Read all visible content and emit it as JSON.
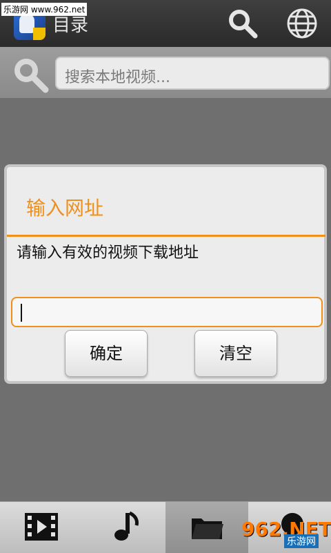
{
  "watermark": "乐游网 www.962.net",
  "header": {
    "title": "目录"
  },
  "search": {
    "placeholder": "搜索本地视频..."
  },
  "dialog": {
    "title": "输入网址",
    "message": "请输入有效的视频下载地址",
    "input_value": "",
    "ok_label": "确定",
    "clear_label": "清空"
  },
  "bottom_tabs": [
    {
      "icon": "video-icon"
    },
    {
      "icon": "music-icon"
    },
    {
      "icon": "folder-icon",
      "active": true
    },
    {
      "icon": "partial-icon-under-watermark"
    }
  ],
  "brand": {
    "logo_text": "962.NET",
    "logo_subtext": "乐游网"
  },
  "colors": {
    "accent": "#f08f1a"
  }
}
